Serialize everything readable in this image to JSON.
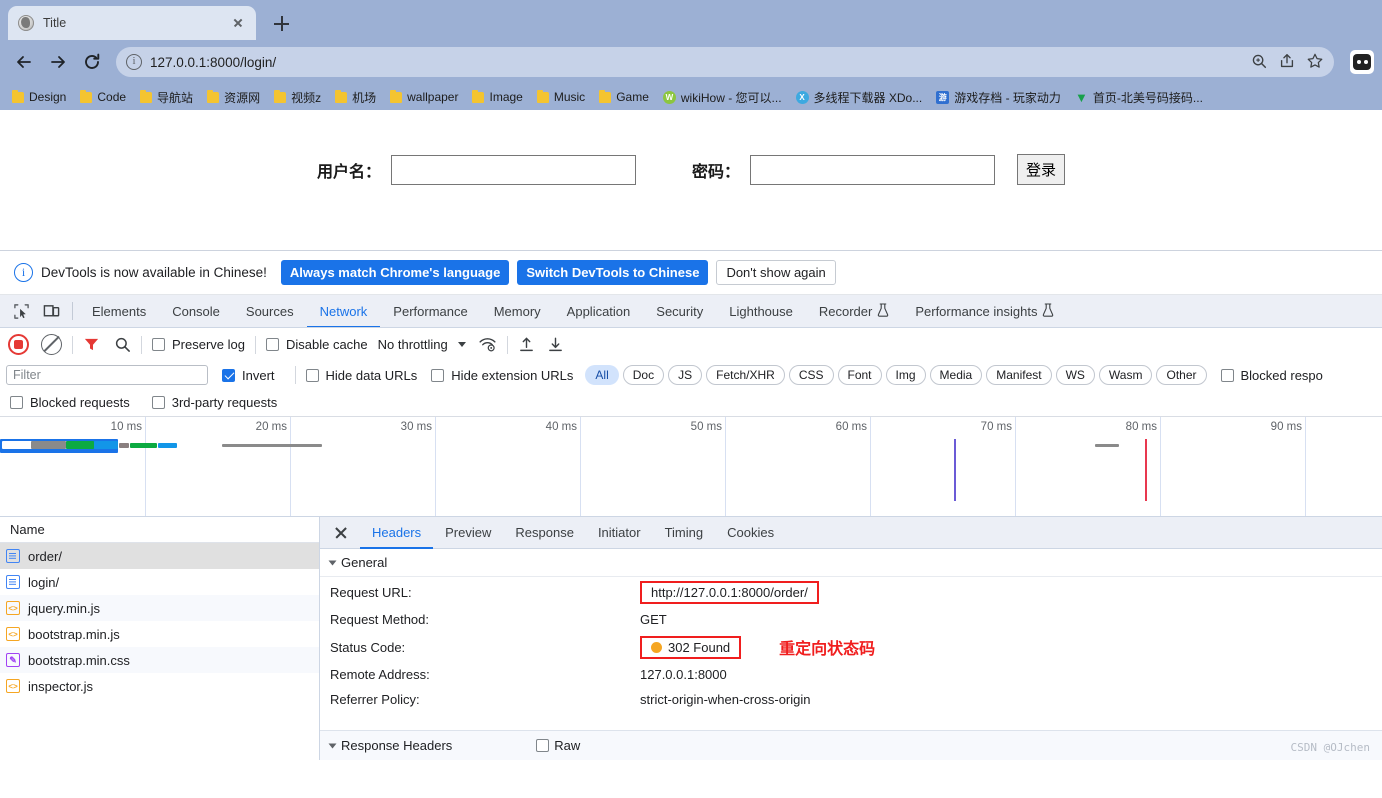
{
  "browser": {
    "tab": {
      "title": "Title",
      "favicon": "globe-icon",
      "close": "×"
    },
    "new_tab_label": "+",
    "nav": {
      "back": "←",
      "forward": "→",
      "reload": "⟳"
    },
    "omnibox": {
      "url": "127.0.0.1:8000/login/",
      "info_icon": "info-circle-icon"
    },
    "omnibox_actions": [
      "zoom-search-icon",
      "share-icon",
      "star-icon"
    ],
    "profile": "profile-avatar",
    "bookmarks": [
      {
        "label": "Design",
        "icon": "folder-icon",
        "color": "#f4c430"
      },
      {
        "label": "Code",
        "icon": "folder-icon",
        "color": "#f4c430"
      },
      {
        "label": "导航站",
        "icon": "folder-icon",
        "color": "#f4c430"
      },
      {
        "label": "资源网",
        "icon": "folder-icon",
        "color": "#f4c430"
      },
      {
        "label": "视频z",
        "icon": "folder-icon",
        "color": "#f4c430"
      },
      {
        "label": "机场",
        "icon": "folder-icon",
        "color": "#f4c430"
      },
      {
        "label": "wallpaper",
        "icon": "folder-icon",
        "color": "#f4c430"
      },
      {
        "label": "Image",
        "icon": "folder-icon",
        "color": "#f4c430"
      },
      {
        "label": "Music",
        "icon": "folder-icon",
        "color": "#f4c430"
      },
      {
        "label": "Game",
        "icon": "folder-icon",
        "color": "#f4c430"
      },
      {
        "label": "wikiHow - 您可以...",
        "icon": "wikihow-icon",
        "color": "#8cc63f"
      },
      {
        "label": "多线程下载器 XDo...",
        "icon": "xdown-icon",
        "color": "#3da9e0"
      },
      {
        "label": "游戏存档 - 玩家动力",
        "icon": "game-archive-icon",
        "color": "#2f6fd0"
      },
      {
        "label": "首页-北美号码接码...",
        "icon": "v-logo-icon",
        "color": "#17a04a"
      }
    ]
  },
  "page": {
    "username_label": "用户名：",
    "username_value": "",
    "password_label": "密码：",
    "password_value": "",
    "login_button": "登录"
  },
  "devtools": {
    "notice": {
      "icon": "info-icon",
      "text": "DevTools is now available in Chinese!",
      "primary_button": "Always match Chrome's language",
      "secondary_button": "Switch DevTools to Chinese",
      "dismiss_button": "Don't show again"
    },
    "panel_tabs": [
      {
        "label": "Elements",
        "active": false
      },
      {
        "label": "Console",
        "active": false
      },
      {
        "label": "Sources",
        "active": false
      },
      {
        "label": "Network",
        "active": true
      },
      {
        "label": "Performance",
        "active": false
      },
      {
        "label": "Memory",
        "active": false
      },
      {
        "label": "Application",
        "active": false
      },
      {
        "label": "Security",
        "active": false
      },
      {
        "label": "Lighthouse",
        "active": false
      },
      {
        "label": "Recorder",
        "active": false,
        "flask": true
      },
      {
        "label": "Performance insights",
        "active": false,
        "flask": true
      }
    ],
    "toolbar": {
      "record_icon": "record-stop-icon",
      "clear_icon": "clear-icon",
      "filter_icon": "funnel-icon",
      "search_icon": "search-icon",
      "preserve_log": {
        "label": "Preserve log",
        "checked": false
      },
      "disable_cache": {
        "label": "Disable cache",
        "checked": false
      },
      "throttling": "No throttling",
      "wifi_icon": "network-conditions-icon",
      "import_icon": "import-har-icon",
      "export_icon": "export-har-icon"
    },
    "filters": {
      "input_placeholder": "Filter",
      "input_value": "",
      "invert": {
        "label": "Invert",
        "checked": true
      },
      "hide_data_urls": {
        "label": "Hide data URLs",
        "checked": false
      },
      "hide_extension_urls": {
        "label": "Hide extension URLs",
        "checked": false
      },
      "types": [
        "All",
        "Doc",
        "JS",
        "Fetch/XHR",
        "CSS",
        "Font",
        "Img",
        "Media",
        "Manifest",
        "WS",
        "Wasm",
        "Other"
      ],
      "active_type": "All",
      "blocked_responses": {
        "label": "Blocked respo",
        "checked": false
      },
      "blocked_requests": {
        "label": "Blocked requests",
        "checked": false
      },
      "third_party_requests": {
        "label": "3rd-party requests",
        "checked": false
      }
    },
    "overview": {
      "ticks": [
        "10 ms",
        "20 ms",
        "30 ms",
        "40 ms",
        "50 ms",
        "60 ms",
        "70 ms",
        "80 ms",
        "90 ms"
      ],
      "accent_blue": "#1a73e8",
      "accent_green": "#0caa41",
      "accent_gray": "#8a8a8a",
      "accent_red": "#e8384f",
      "accent_purple": "#6b5bd6"
    },
    "requests": {
      "column_header": "Name",
      "rows": [
        {
          "name": "order/",
          "type": "doc",
          "selected": true
        },
        {
          "name": "login/",
          "type": "doc",
          "selected": false
        },
        {
          "name": "jquery.min.js",
          "type": "js",
          "selected": false
        },
        {
          "name": "bootstrap.min.js",
          "type": "js",
          "selected": false
        },
        {
          "name": "bootstrap.min.css",
          "type": "css",
          "selected": false
        },
        {
          "name": "inspector.js",
          "type": "js",
          "selected": false
        }
      ]
    },
    "detail": {
      "tabs": [
        {
          "label": "Headers",
          "active": true
        },
        {
          "label": "Preview",
          "active": false
        },
        {
          "label": "Response",
          "active": false
        },
        {
          "label": "Initiator",
          "active": false
        },
        {
          "label": "Timing",
          "active": false
        },
        {
          "label": "Cookies",
          "active": false
        }
      ],
      "general_section": "General",
      "general_rows": [
        {
          "key": "Request URL:",
          "value": "http://127.0.0.1:8000/order/",
          "highlight": true
        },
        {
          "key": "Request Method:",
          "value": "GET",
          "highlight": false
        },
        {
          "key": "Status Code:",
          "value": "302 Found",
          "highlight": true,
          "status_dot": "#f5a623"
        },
        {
          "key": "Remote Address:",
          "value": "127.0.0.1:8000",
          "highlight": false
        },
        {
          "key": "Referrer Policy:",
          "value": "strict-origin-when-cross-origin",
          "highlight": false
        }
      ],
      "annotation": "重定向状态码",
      "annotation_color": "#f01e1e",
      "response_headers_section": "Response Headers",
      "raw_toggle": {
        "label": "Raw",
        "checked": false
      }
    }
  },
  "watermark": "CSDN @OJchen"
}
